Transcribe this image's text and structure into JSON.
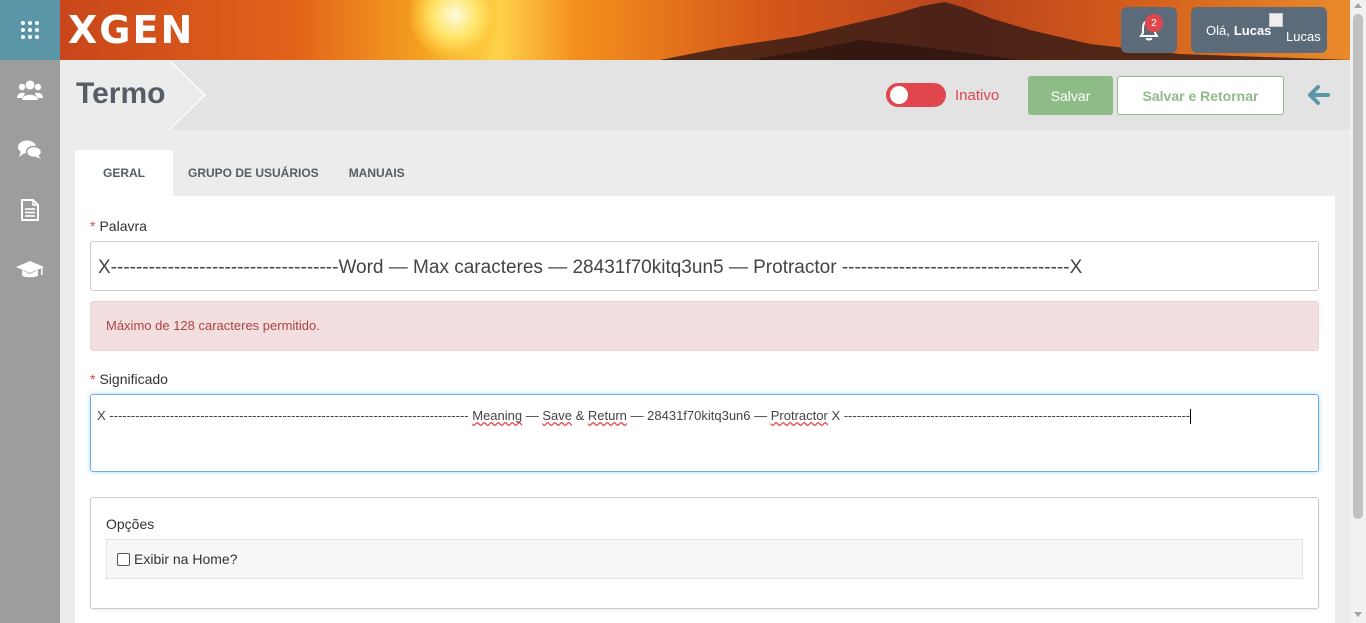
{
  "app": {
    "logo": "XGEN"
  },
  "header": {
    "notifications_count": "2",
    "greeting": "Olá,",
    "user_name": "Lucas",
    "avatar_alt": "Lucas"
  },
  "sidebar": {
    "items": [
      {
        "icon": "apps-grid-icon"
      },
      {
        "icon": "users-icon"
      },
      {
        "icon": "chat-icon"
      },
      {
        "icon": "document-icon"
      },
      {
        "icon": "graduation-cap-icon"
      }
    ]
  },
  "page": {
    "title": "Termo",
    "status_label": "Inativo",
    "save_label": "Salvar",
    "save_return_label": "Salvar e Retornar"
  },
  "tabs": [
    {
      "label": "GERAL",
      "active": true
    },
    {
      "label": "GRUPO DE USUÁRIOS",
      "active": false
    },
    {
      "label": "MANUAIS",
      "active": false
    }
  ],
  "form": {
    "word_label": "Palavra",
    "word_value": "X------------------------------------Word — Max caracteres — 28431f70kitq3un5 — Protractor ------------------------------------X",
    "error_message": "Máximo de 128 caracteres permitido.",
    "meaning_label": "Significado",
    "meaning_prefix": "X -----------------------------------------------------------------------------------",
    "meaning_w1": "Meaning",
    "meaning_s1": " — ",
    "meaning_w2": "Save",
    "meaning_s2": " & ",
    "meaning_w3": "Return",
    "meaning_s3": " — 28431f70kitq3un6 — ",
    "meaning_w4": "Protractor",
    "meaning_suffix": " X --------------------------------------------------------------------------------",
    "options_title": "Opções",
    "show_home_label": "Exibir na Home?",
    "show_home_checked": false
  },
  "colors": {
    "sidebar_bg": "#9d9d9d",
    "apps_bg": "#5b96a8",
    "danger": "#e0464e",
    "success": "#8ebc87",
    "header_button_bg": "#5b6b7a"
  }
}
